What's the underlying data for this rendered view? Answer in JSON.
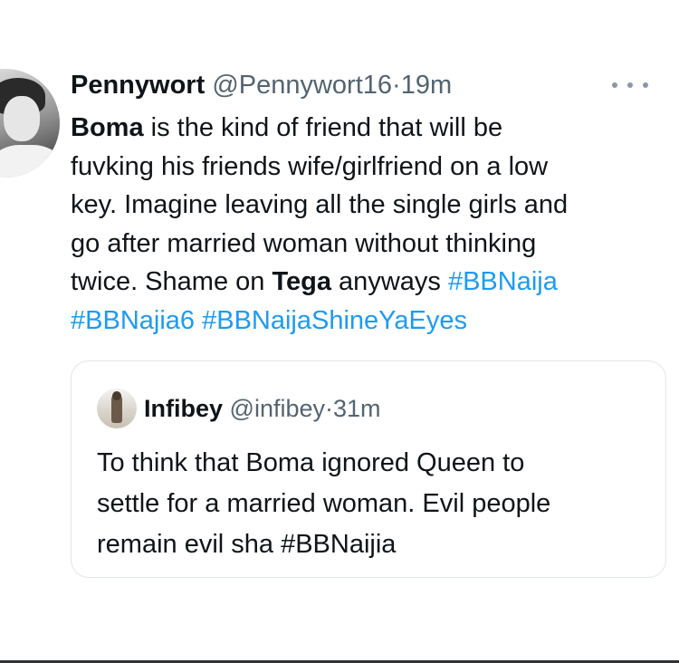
{
  "tweet": {
    "author": {
      "display_name": "Pennywort",
      "handle": "@Pennywort16",
      "separator": "·",
      "time": "19m"
    },
    "more_icon": "more-horizontal-icon",
    "text_lines": [
      [
        {
          "text": "Boma",
          "style": "bold"
        },
        {
          "text": " is the kind of friend that will be",
          "style": "plain"
        }
      ],
      [
        {
          "text": "fuvking his friends wife/girlfriend on a low",
          "style": "plain"
        }
      ],
      [
        {
          "text": "key. Imagine leaving all the single girls and",
          "style": "plain"
        }
      ],
      [
        {
          "text": "go after married woman without thinking",
          "style": "plain"
        }
      ],
      [
        {
          "text": "twice. Shame on ",
          "style": "plain"
        },
        {
          "text": "Tega",
          "style": "bold"
        },
        {
          "text": " anyways ",
          "style": "plain"
        },
        {
          "text": "#BBNaija",
          "style": "hashtag"
        }
      ],
      [
        {
          "text": "#BBNajia6",
          "style": "hashtag"
        },
        {
          "text": " ",
          "style": "plain"
        },
        {
          "text": "#BBNaijaShineYaEyes",
          "style": "hashtag"
        }
      ]
    ],
    "colors": {
      "text": "#0f1419",
      "muted": "#536471",
      "hashtag": "#1d9bf0",
      "border": "#e1e6ea"
    }
  },
  "quote": {
    "author": {
      "display_name": "Infibey",
      "handle": "@infibey",
      "separator": "·",
      "time": "31m"
    },
    "text_lines": [
      "To think that Boma ignored Queen to",
      "settle for a married woman. Evil people",
      "remain evil sha #BBNaijia"
    ]
  }
}
